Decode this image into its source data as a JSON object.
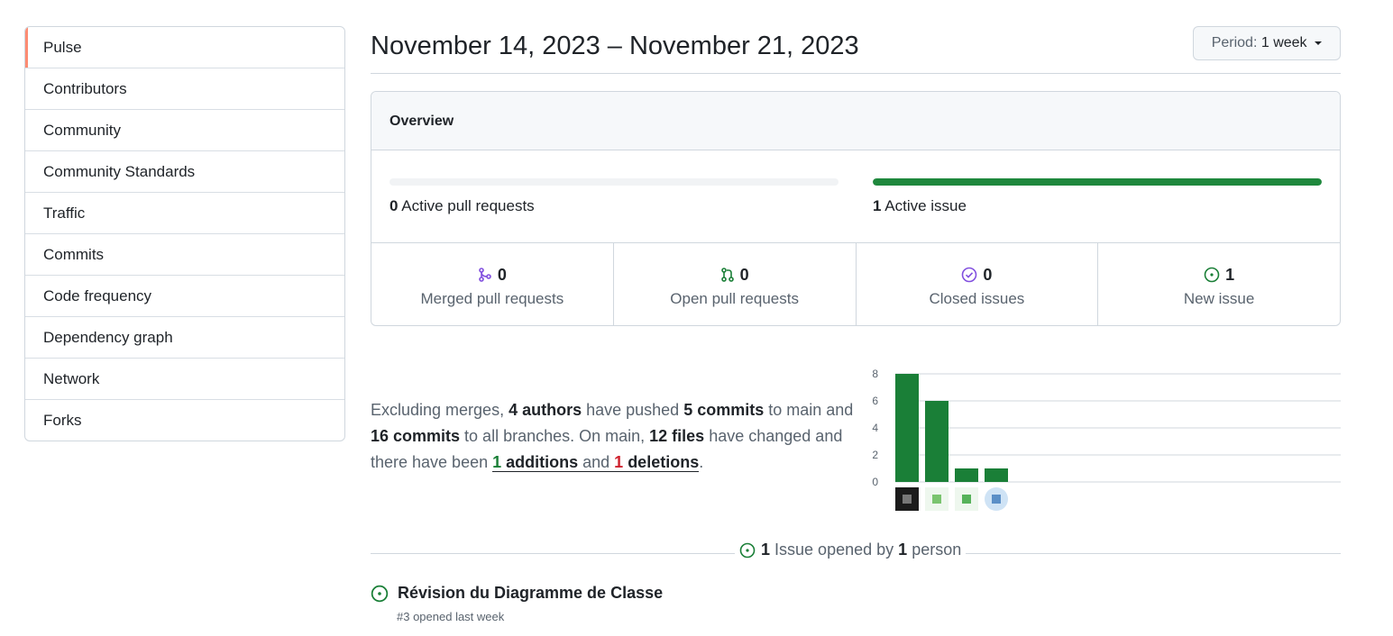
{
  "sidebar": {
    "items": [
      {
        "label": "Pulse",
        "selected": true
      },
      {
        "label": "Contributors"
      },
      {
        "label": "Community"
      },
      {
        "label": "Community Standards"
      },
      {
        "label": "Traffic"
      },
      {
        "label": "Commits"
      },
      {
        "label": "Code frequency"
      },
      {
        "label": "Dependency graph"
      },
      {
        "label": "Network"
      },
      {
        "label": "Forks"
      }
    ]
  },
  "header": {
    "date_range": "November 14, 2023 – November 21, 2023",
    "period_label": "Period:",
    "period_value": "1 week"
  },
  "overview": {
    "title": "Overview",
    "pull_requests": {
      "count": "0",
      "label": "Active pull requests",
      "fill_percent": 0
    },
    "issues": {
      "count": "1",
      "label": "Active issue",
      "fill_percent": 100
    },
    "stats": [
      {
        "count": "0",
        "label": "Merged pull requests",
        "icon": "git-merge-icon",
        "color": "#8250df"
      },
      {
        "count": "0",
        "label": "Open pull requests",
        "icon": "git-pull-request-icon",
        "color": "#1a7f37"
      },
      {
        "count": "0",
        "label": "Closed issues",
        "icon": "issue-closed-icon",
        "color": "#8250df"
      },
      {
        "count": "1",
        "label": "New issue",
        "icon": "issue-opened-icon",
        "color": "#1a7f37"
      }
    ]
  },
  "summary": {
    "t1": "Excluding merges, ",
    "authors": "4 authors",
    "t2": " have pushed ",
    "commits": "5 commits",
    "t3": " to main and ",
    "branch_commits": "16 commits",
    "t4": " to all branches. On main, ",
    "files": "12 files",
    "t5": " have changed and there have been ",
    "additions_count": "1",
    "additions_word": " additions",
    "and": " and ",
    "deletions_count": "1",
    "deletions_word": " deletions",
    "period": "."
  },
  "chart_data": {
    "type": "bar",
    "categories": [
      "author-1",
      "author-2",
      "author-3",
      "author-4"
    ],
    "values": [
      8,
      6,
      1,
      1
    ],
    "ylim": [
      0,
      8
    ],
    "yticks": [
      "0",
      "2",
      "4",
      "6",
      "8"
    ],
    "grid": true,
    "bar_color": "#1a7f37"
  },
  "issues_section": {
    "count": "1",
    "issue_word": "Issue opened by",
    "person_count": "1",
    "person_word": "person",
    "issue": {
      "title": "Révision du Diagramme de Classe",
      "meta": "#3 opened last week"
    }
  },
  "colors": {
    "accent_green": "#1f883d",
    "selected_marker": "#fd8c73",
    "purple": "#8250df"
  }
}
